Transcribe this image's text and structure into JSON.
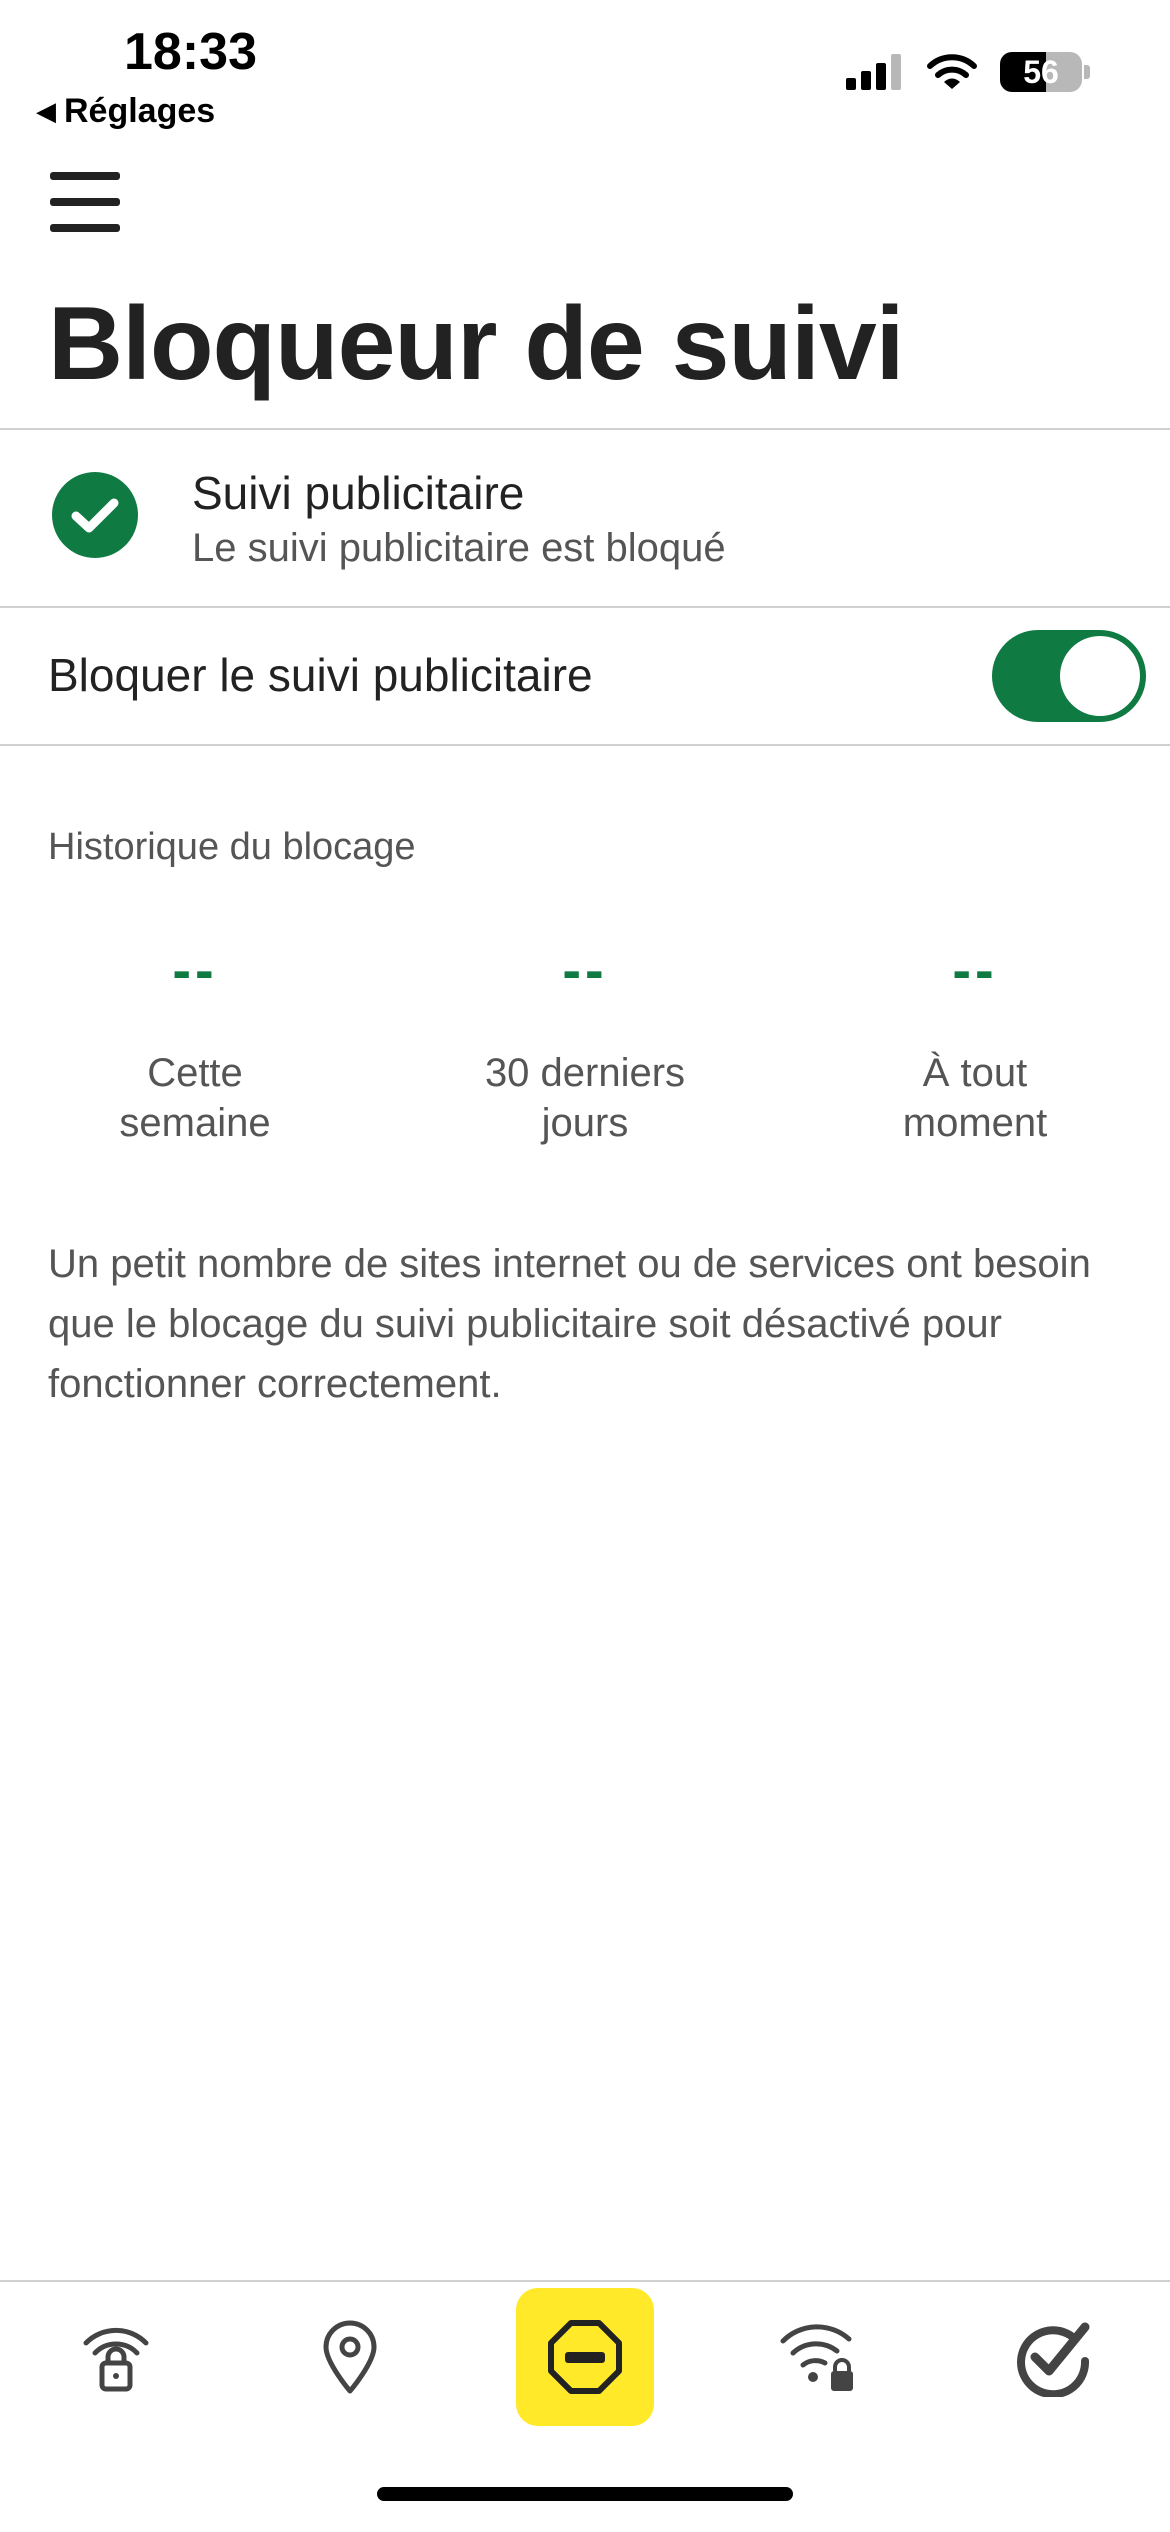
{
  "status_bar": {
    "time": "18:33",
    "back_label": "Réglages",
    "battery_level": "56",
    "battery_percent": 56,
    "icons": [
      "signal-icon",
      "wifi-icon",
      "battery-icon"
    ]
  },
  "header": {
    "menu_icon": "hamburger-menu-icon",
    "title": "Bloqueur de suivi"
  },
  "status": {
    "icon": "check-circle-icon",
    "title": "Suivi publicitaire",
    "subtitle": "Le suivi publicitaire est bloqué"
  },
  "toggle": {
    "label": "Bloquer le suivi publicitaire",
    "on": true
  },
  "history": {
    "heading": "Historique du blocage",
    "stats": [
      {
        "value": "--",
        "label": "Cette\nsemaine"
      },
      {
        "value": "--",
        "label": "30 derniers\njours"
      },
      {
        "value": "--",
        "label": "À tout\nmoment"
      }
    ]
  },
  "description": "Un petit nombre de sites internet ou de services ont besoin que le blocage du suivi publicitaire soit désactivé pour fonctionner correctement.",
  "tab_bar": {
    "tabs": [
      {
        "icon": "secure-wifi-lock-icon",
        "active": false
      },
      {
        "icon": "location-pin-icon",
        "active": false
      },
      {
        "icon": "block-stop-icon",
        "active": true
      },
      {
        "icon": "wifi-lock-icon",
        "active": false
      },
      {
        "icon": "norton-check-icon",
        "active": false
      }
    ]
  },
  "colors": {
    "accent_green": "#0f7a42",
    "active_tab": "#ffe928",
    "text": "#222222",
    "secondary_text": "#555555"
  }
}
